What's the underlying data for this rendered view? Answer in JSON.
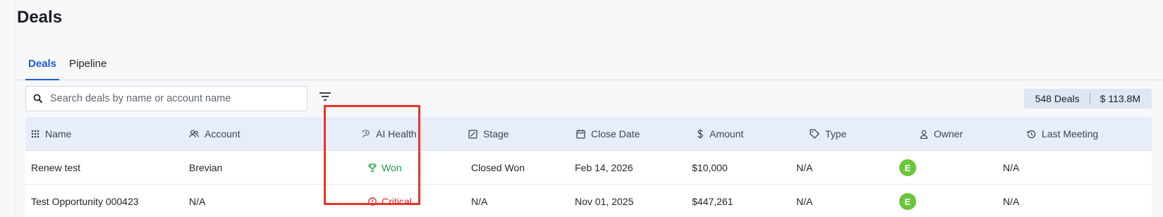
{
  "page": {
    "title": "Deals"
  },
  "tabs": [
    {
      "label": "Deals",
      "active": true
    },
    {
      "label": "Pipeline",
      "active": false
    }
  ],
  "search": {
    "placeholder": "Search deals by name or account name",
    "value": ""
  },
  "summary": {
    "count": "548 Deals",
    "total": "$ 113.8M"
  },
  "table": {
    "columns": [
      {
        "label": "Name",
        "icon": "drag-grid-icon"
      },
      {
        "label": "Account",
        "icon": "people-icon"
      },
      {
        "label": "AI Health",
        "icon": "ai-health-icon"
      },
      {
        "label": "Stage",
        "icon": "stage-icon"
      },
      {
        "label": "Close Date",
        "icon": "calendar-icon"
      },
      {
        "label": "Amount",
        "icon": "dollar-icon"
      },
      {
        "label": "Type",
        "icon": "tag-icon"
      },
      {
        "label": "Owner",
        "icon": "person-icon"
      },
      {
        "label": "Last Meeting",
        "icon": "history-icon"
      }
    ],
    "rows": [
      {
        "name": "Renew test",
        "account": "Brevian",
        "health": "Won",
        "health_icon": "trophy-icon",
        "stage": "Closed Won",
        "close_date": "Feb 14, 2026",
        "amount": "$10,000",
        "type": "N/A",
        "owner_initial": "E",
        "last_meeting": "N/A"
      },
      {
        "name": "Test Opportunity 000423",
        "account": "N/A",
        "health": "Critical",
        "health_icon": "alert-circle-icon",
        "stage": "N/A",
        "close_date": "Nov 01, 2025",
        "amount": "$447,261",
        "type": "N/A",
        "owner_initial": "E",
        "last_meeting": "N/A"
      }
    ]
  },
  "colors": {
    "accent": "#1e5bd8",
    "won": "#1c9b3d",
    "critical": "#d62a2a",
    "avatar": "#6ac53c",
    "highlight": "#e8332a"
  }
}
